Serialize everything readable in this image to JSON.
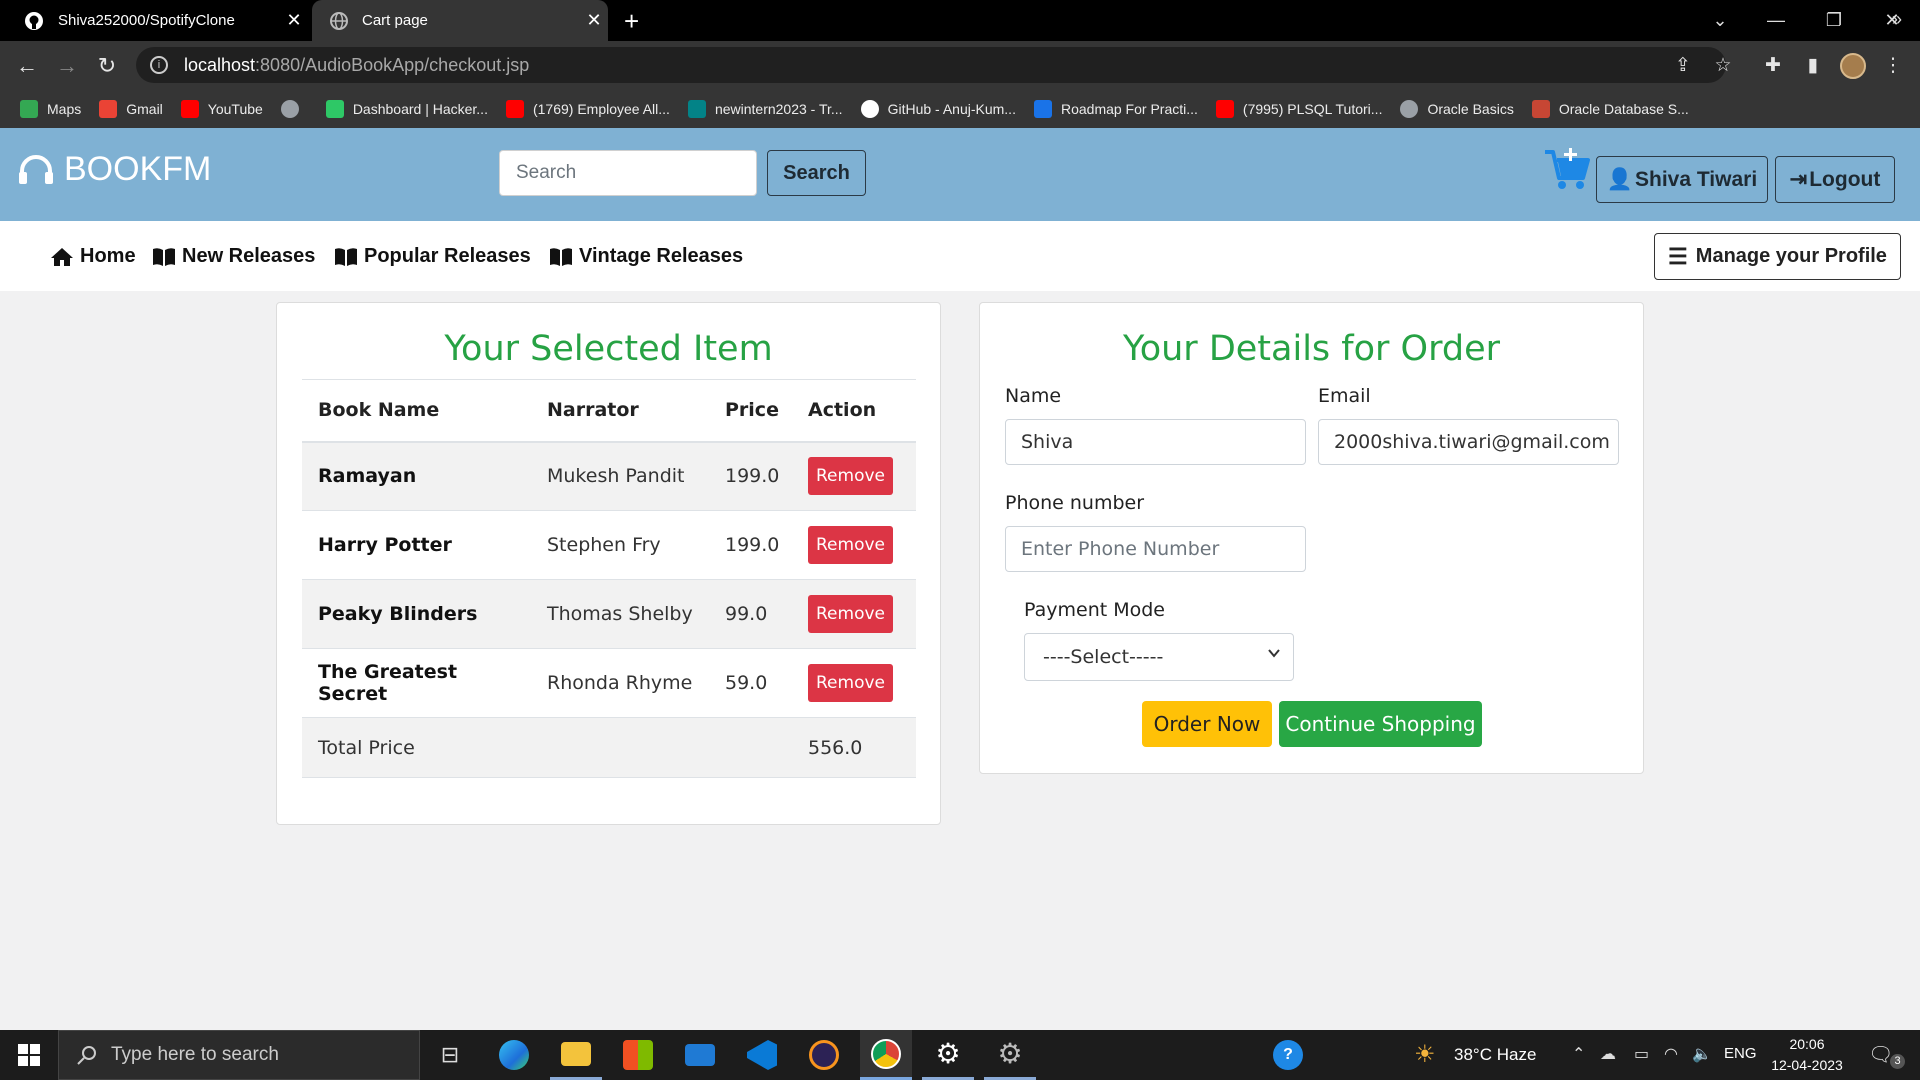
{
  "browser": {
    "tabs": [
      {
        "title": "Shiva252000/SpotifyClone",
        "icon": "github-icon"
      },
      {
        "title": "Cart page",
        "icon": "globe-icon"
      }
    ],
    "url_host": "localhost",
    "url_path": ":8080/AudioBookApp/checkout.jsp",
    "bookmarks": [
      {
        "label": "Maps",
        "icon": "maps-icon",
        "color": "#34a853"
      },
      {
        "label": "Gmail",
        "icon": "gmail-icon",
        "color": "#ea4335"
      },
      {
        "label": "YouTube",
        "icon": "youtube-icon",
        "color": "#ff0000"
      },
      {
        "label": "",
        "icon": "globe-icon",
        "color": "#9aa0a6"
      },
      {
        "label": "Dashboard | Hacker...",
        "icon": "hackerrank-icon",
        "color": "#2ec866"
      },
      {
        "label": "(1769) Employee All...",
        "icon": "youtube-icon",
        "color": "#ff0000"
      },
      {
        "label": "newintern2023 - Tr...",
        "icon": "sharepoint-icon",
        "color": "#038387"
      },
      {
        "label": "GitHub - Anuj-Kum...",
        "icon": "github-icon",
        "color": "#ffffff"
      },
      {
        "label": "Roadmap For Practi...",
        "icon": "infinity-icon",
        "color": "#1a73e8"
      },
      {
        "label": "(7995) PLSQL Tutori...",
        "icon": "youtube-icon",
        "color": "#ff0000"
      },
      {
        "label": "Oracle Basics",
        "icon": "globe-icon",
        "color": "#9aa0a6"
      },
      {
        "label": "Oracle Database S...",
        "icon": "oracle-icon",
        "color": "#c74634"
      }
    ]
  },
  "header": {
    "brand": "BOOKFM",
    "search_placeholder": "Search",
    "search_button": "Search",
    "user_button": "Shiva Tiwari",
    "logout_button": "Logout"
  },
  "nav": {
    "items": [
      "Home",
      "New Releases",
      "Popular Releases",
      "Vintage Releases"
    ],
    "manage_profile": "Manage your Profile"
  },
  "cart": {
    "title": "Your Selected Item",
    "columns": [
      "Book Name",
      "Narrator",
      "Price",
      "Action"
    ],
    "rows": [
      {
        "book": "Ramayan",
        "narrator": "Mukesh Pandit",
        "price": "199.0",
        "action": "Remove"
      },
      {
        "book": "Harry Potter",
        "narrator": "Stephen Fry",
        "price": "199.0",
        "action": "Remove"
      },
      {
        "book": "Peaky Blinders",
        "narrator": "Thomas Shelby",
        "price": "99.0",
        "action": "Remove"
      },
      {
        "book": "The Greatest Secret",
        "narrator": "Rhonda Rhyme",
        "price": "59.0",
        "action": "Remove"
      }
    ],
    "total_label": "Total Price",
    "total_value": "556.0"
  },
  "order": {
    "title": "Your Details for Order",
    "name_label": "Name",
    "name_value": "Shiva",
    "email_label": "Email",
    "email_value": "2000shiva.tiwari@gmail.com",
    "phone_label": "Phone number",
    "phone_placeholder": "Enter Phone Number",
    "payment_label": "Payment Mode",
    "payment_selected": "----Select-----",
    "order_button": "Order Now",
    "continue_button": "Continue Shopping"
  },
  "taskbar": {
    "search_placeholder": "Type here to search",
    "weather": "38°C  Haze",
    "language": "ENG",
    "time": "20:06",
    "date": "12-04-2023",
    "notification_count": "3"
  },
  "colors": {
    "header_bg": "#7fb1d3",
    "title_green": "#27a244",
    "remove_red": "#dc3545",
    "order_yellow": "#ffc107",
    "continue_green": "#28a745",
    "cart_blue": "#1e88e5"
  }
}
